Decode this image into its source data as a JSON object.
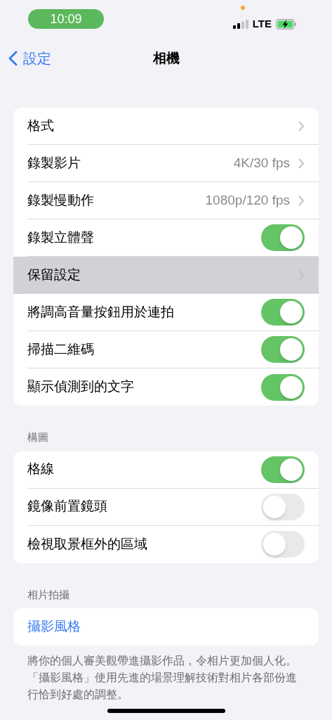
{
  "status_bar": {
    "time": "10:09",
    "network": "LTE"
  },
  "nav": {
    "back": "設定",
    "title": "相機"
  },
  "groups": [
    {
      "rows": [
        {
          "kind": "link",
          "label": "格式",
          "highlighted": false
        },
        {
          "kind": "link",
          "label": "錄製影片",
          "value": "4K/30 fps",
          "highlighted": false
        },
        {
          "kind": "link",
          "label": "錄製慢動作",
          "value": "1080p/120 fps",
          "highlighted": false
        },
        {
          "kind": "toggle",
          "label": "錄製立體聲",
          "on": true,
          "highlighted": false
        },
        {
          "kind": "link",
          "label": "保留設定",
          "highlighted": true
        },
        {
          "kind": "toggle",
          "label": "將調高音量按鈕用於連拍",
          "on": true,
          "highlighted": false
        },
        {
          "kind": "toggle",
          "label": "掃描二維碼",
          "on": true,
          "highlighted": false
        },
        {
          "kind": "toggle",
          "label": "顯示偵測到的文字",
          "on": true,
          "highlighted": false
        }
      ]
    },
    {
      "header": "構圖",
      "rows": [
        {
          "kind": "toggle",
          "label": "格線",
          "on": true,
          "highlighted": false
        },
        {
          "kind": "toggle",
          "label": "鏡像前置鏡頭",
          "on": false,
          "highlighted": false
        },
        {
          "kind": "toggle",
          "label": "檢視取景框外的區域",
          "on": false,
          "highlighted": false
        }
      ]
    },
    {
      "header": "相片拍攝",
      "rows": [
        {
          "kind": "action",
          "label": "攝影風格",
          "highlighted": false
        }
      ],
      "footer": "將你的個人審美觀帶進攝影作品，令相片更加個人化。「攝影風格」使用先進的場景理解技術對相片各部份進行恰到好處的調整。"
    }
  ]
}
